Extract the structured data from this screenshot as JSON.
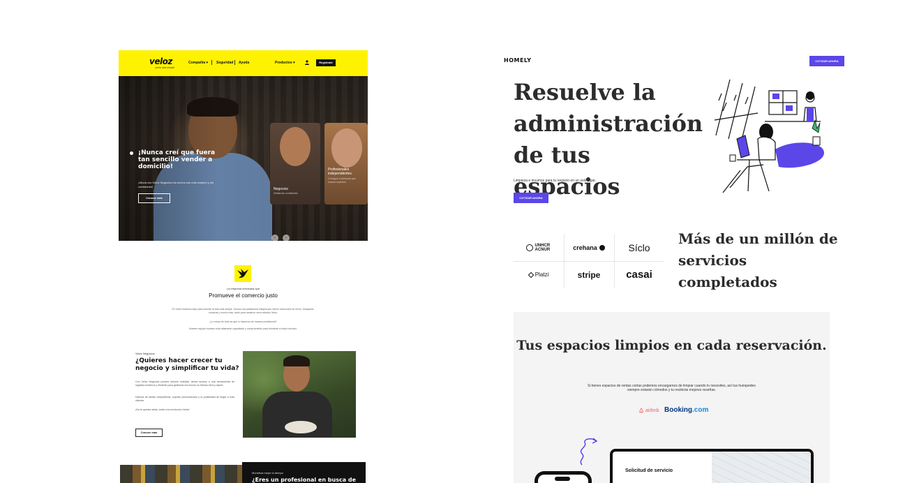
{
  "veloz": {
    "nav": {
      "logo": "veloz",
      "logo_tagline": "¡seria más simple!",
      "items": [
        "Compañía ▾",
        "Seguridad",
        "Ayuda"
      ],
      "products": "Productos ▾",
      "register": "Registrate",
      "brand_color": "#fff200"
    },
    "hero": {
      "title": "¡Nunca creí que fuera tan sencillo vender a domicilio!",
      "subtitle": "¡Ahora con Veloz Negocios tus envíos son más simples y sin comisiones!",
      "cta": "Conoce más",
      "cards": [
        {
          "label": "Negocios",
          "sub": "Ventas sin comisiones"
        },
        {
          "label": "Profesionales independientes",
          "sub": "Consigue a personas que buscan expertos"
        }
      ],
      "prev_arrow": "‹",
      "next_arrow": "›"
    },
    "about": {
      "small": "La empresa mexicana que",
      "title": "Promueve el comercio justo",
      "p1": "En Veloz estamos aquí para hacerte la vida más simple. Somos una plataforma integral que ofrece soluciones de envío, transporte, compras y mucho más, tanto para usuarios como aliados Veloz.",
      "p2": "¿Lo mejor de todo es que lo hacemos de manera profesional?",
      "p3": "Nuestro equipo humano está altamente capacitado y comprometido para brindarte el mejor servicio."
    },
    "business": {
      "small": "Veloz Negocios",
      "title": "¿Quieres hacer crecer tu negocio y simplificar tu vida?",
      "p1": "Con Veloz Negocios puedes hacerlo realidad, tienes acceso a una herramienta de logística moderna y eficiente para gestionar tus envíos en Mexico fácil y rápido.",
      "p2": "Disfruta de tarifas competitivas, soporte personalizado y la posibilidad de llegar a más clientes.",
      "p3": "¡No te quedes atrás, únete a la revolución Veloz!",
      "cta": "Conoce más"
    },
    "bottom": {
      "small": "Monetiza mejor tu tiempo",
      "title": "¿Eres un profesional en busca de"
    }
  },
  "homely": {
    "logo": "HOMELY",
    "top_button": "COTIZAR AHORA",
    "hero_title": "Resuelve la administración de tus espacios",
    "hero_sub": "Limpieza e insumos para tu negocio en un solo lugar.",
    "hero_button": "COTIZAR AHORA",
    "accent": "#5b46e8",
    "clients": [
      "UNHCR ACNUR",
      "crehana",
      "Síclo",
      "Platzi",
      "stripe",
      "casai"
    ],
    "stat": "Más de un millón de servicios completados",
    "panel": {
      "title": "Tus espacios limpios en cada reservación.",
      "sub": "Si tienes espacios de rentas cortas podemos encargarnos de limpiar cuando lo necesites, así tus huéspedes siempre estarán cómodos y tu recibirás mejores reseñas.",
      "airbnb": "airbnb",
      "booking_a": "Booking",
      "booking_b": ".com",
      "device_title": "Solicitud de servicio"
    }
  }
}
